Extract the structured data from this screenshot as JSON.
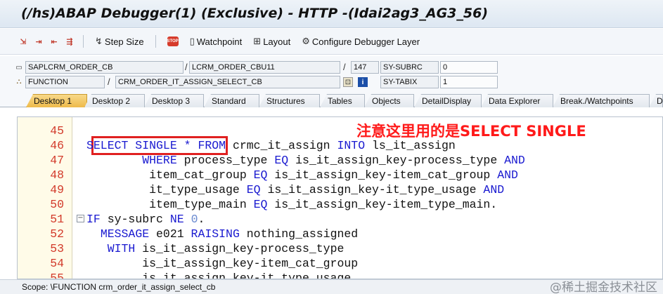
{
  "window": {
    "title": "(/hs)ABAP Debugger(1)  (Exclusive) - HTTP -(Idai2ag3_AG3_56)"
  },
  "toolbar": {
    "step_size": "Step Size",
    "stop_label": "STOP",
    "watchpoint": "Watchpoint",
    "layout": "Layout",
    "configure": "Configure Debugger Layer"
  },
  "fields": {
    "program": "SAPLCRM_ORDER_CB",
    "include": "LCRM_ORDER_CBU11",
    "line": "147",
    "sysvar1_name": "SY-SUBRC",
    "sysvar1_value": "0",
    "event_type": "FUNCTION",
    "event_name": "CRM_ORDER_IT_ASSIGN_SELECT_CB",
    "sysvar2_name": "SY-TABIX",
    "sysvar2_value": "1"
  },
  "tabs": [
    "Desktop 1",
    "Desktop 2",
    "Desktop 3",
    "Standard",
    "Structures",
    "Tables",
    "Objects",
    "DetailDisplay",
    "Data Explorer",
    "Break./Watchpoints",
    "Di"
  ],
  "editor": {
    "annotation": "注意这里用的是SELECT SINGLE",
    "lines": [
      {
        "n": "45",
        "tokens": []
      },
      {
        "n": "46",
        "tokens": [
          [
            "kw",
            "SELECT SINGLE "
          ],
          [
            "kw",
            "*"
          ],
          [
            "txt",
            " "
          ],
          [
            "kw",
            "FROM"
          ],
          [
            "txt",
            " crmc_it_assign "
          ],
          [
            "kw",
            "INTO"
          ],
          [
            "txt",
            " ls_it_assign"
          ]
        ]
      },
      {
        "n": "47",
        "tokens": [
          [
            "txt",
            "        "
          ],
          [
            "kw",
            "WHERE"
          ],
          [
            "txt",
            " process_type "
          ],
          [
            "kw",
            "EQ"
          ],
          [
            "txt",
            " is_it_assign_key-process_type "
          ],
          [
            "kw",
            "AND"
          ]
        ]
      },
      {
        "n": "48",
        "tokens": [
          [
            "txt",
            "         item_cat_group "
          ],
          [
            "kw",
            "EQ"
          ],
          [
            "txt",
            " is_it_assign_key-item_cat_group "
          ],
          [
            "kw",
            "AND"
          ]
        ]
      },
      {
        "n": "49",
        "tokens": [
          [
            "txt",
            "         it_type_usage "
          ],
          [
            "kw",
            "EQ"
          ],
          [
            "txt",
            " is_it_assign_key-it_type_usage "
          ],
          [
            "kw",
            "AND"
          ]
        ]
      },
      {
        "n": "50",
        "tokens": [
          [
            "txt",
            "         item_type_main "
          ],
          [
            "kw",
            "EQ"
          ],
          [
            "txt",
            " is_it_assign_key-item_type_main."
          ]
        ]
      },
      {
        "n": "51",
        "fold": "−",
        "tokens": [
          [
            "kw",
            "IF"
          ],
          [
            "txt",
            " sy-subrc "
          ],
          [
            "kw",
            "NE"
          ],
          [
            "txt",
            " "
          ],
          [
            "lit",
            "0"
          ],
          [
            "txt",
            "."
          ]
        ]
      },
      {
        "n": "52",
        "tokens": [
          [
            "txt",
            "  "
          ],
          [
            "kw",
            "MESSAGE"
          ],
          [
            "txt",
            " e021 "
          ],
          [
            "kw",
            "RAISING"
          ],
          [
            "txt",
            " nothing_assigned"
          ]
        ]
      },
      {
        "n": "53",
        "tokens": [
          [
            "txt",
            "   "
          ],
          [
            "kw",
            "WITH"
          ],
          [
            "txt",
            " is_it_assign_key-process_type"
          ]
        ]
      },
      {
        "n": "54",
        "tokens": [
          [
            "txt",
            "        is_it_assign_key-item_cat_group"
          ]
        ]
      },
      {
        "n": "55",
        "tokens": [
          [
            "txt",
            "        is_it_assign_key-it_type_usage"
          ]
        ]
      }
    ]
  },
  "status": {
    "scope": "Scope: \\FUNCTION crm_order_it_assign_select_cb"
  },
  "watermark": "@稀土掘金技术社区",
  "colors": {
    "keyword": "#1a1ad0",
    "line_number": "#d23a2a",
    "annotation": "#ff1a1a",
    "active_tab": "#eeba4a"
  }
}
